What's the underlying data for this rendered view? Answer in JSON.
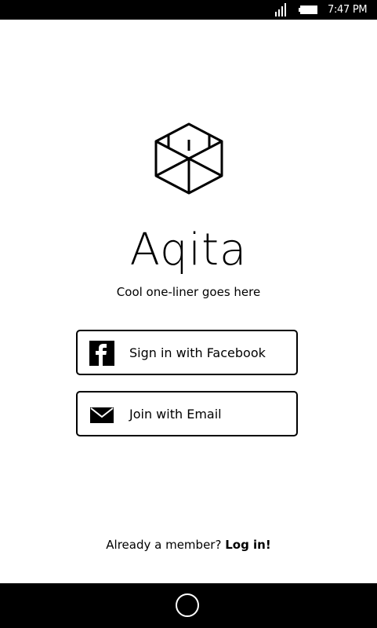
{
  "status_bar": {
    "time": "7:47 PM",
    "signal_icon": "signal-bars-icon",
    "battery_icon": "battery-icon"
  },
  "app": {
    "logo_icon": "open-box-icon",
    "title": "Aqita",
    "tagline": "Cool one-liner goes here"
  },
  "auth": {
    "facebook_label": "Sign in with Facebook",
    "facebook_icon": "facebook-icon",
    "email_label": "Join with Email",
    "email_icon": "envelope-icon"
  },
  "footer": {
    "member_prompt": "Already a member?",
    "login_label": "Log in!"
  },
  "nav_bar": {
    "home_icon": "home-circle-icon"
  },
  "colors": {
    "background": "#ffffff",
    "bars": "#000000",
    "text": "#000000"
  }
}
